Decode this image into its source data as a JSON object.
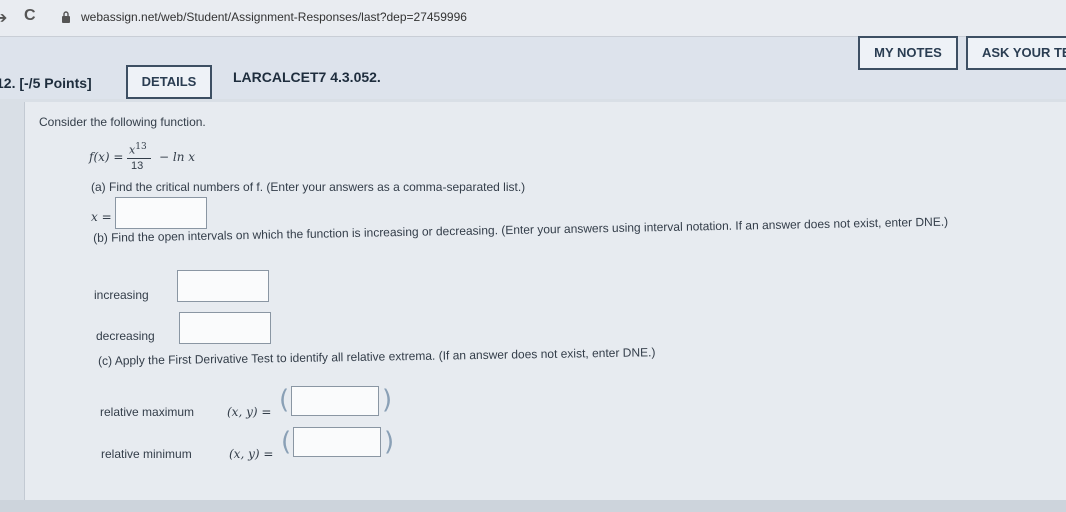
{
  "browser": {
    "back_glyph": "➔",
    "reload_glyph": "C",
    "url": "webassign.net/web/Student/Assignment-Responses/last?dep=27459996"
  },
  "header": {
    "question_number": "12. [-/5 Points]",
    "details_label": "DETAILS",
    "problem_id": "LARCALCET7 4.3.052.",
    "my_notes_label": "MY NOTES",
    "ask_label": "ASK YOUR TE"
  },
  "problem": {
    "intro": "Consider the following function.",
    "function_lhs": "f(x) =",
    "numerator": "x",
    "exponent": "13",
    "denominator": "13",
    "function_rest": "− ln x",
    "part_a": "(a) Find the critical numbers of f. (Enter your answers as a comma-separated list.)",
    "part_a_label": "x =",
    "part_a_value": "",
    "part_b": "(b) Find the open intervals on which the function is increasing or decreasing. (Enter your answers using interval notation. If an answer does not exist, enter DNE.)",
    "increasing_label": "increasing",
    "increasing_value": "",
    "decreasing_label": "decreasing",
    "decreasing_value": "",
    "part_c": "(c) Apply the First Derivative Test to identify all relative extrema. (If an answer does not exist, enter DNE.)",
    "rel_max_label": "relative maximum",
    "rel_min_label": "relative minimum",
    "xy_label": "(x, y) =",
    "rel_max_value": "",
    "rel_min_value": ""
  }
}
